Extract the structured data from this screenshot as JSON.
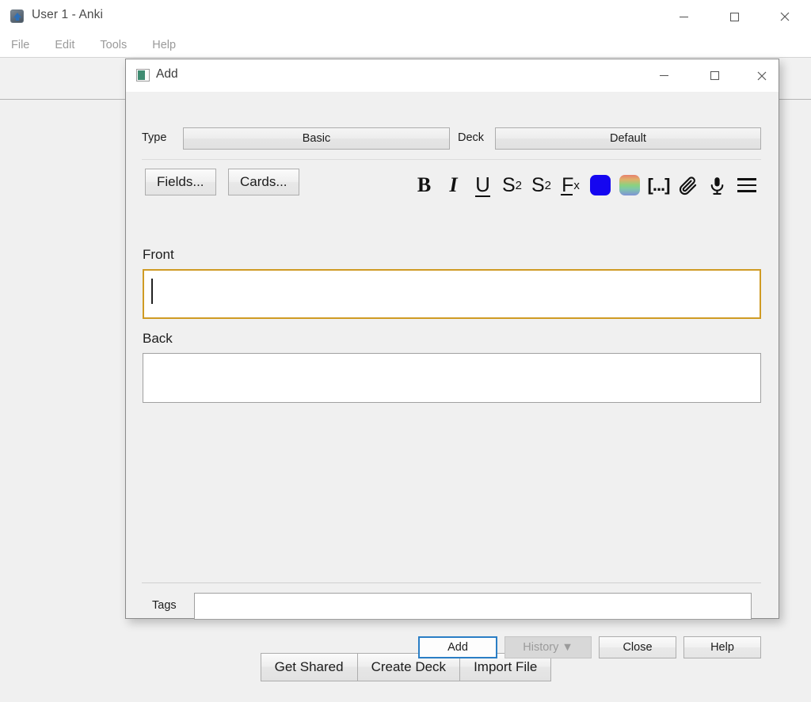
{
  "main_window": {
    "title": "User 1 - Anki",
    "app_icon": "anki-icon",
    "menu": [
      {
        "label": "File"
      },
      {
        "label": "Edit"
      },
      {
        "label": "Tools"
      },
      {
        "label": "Help"
      }
    ],
    "window_controls": {
      "minimize": "minimize-icon",
      "maximize": "maximize-icon",
      "close": "close-icon"
    },
    "bottom_buttons": [
      {
        "label": "Get Shared"
      },
      {
        "label": "Create Deck"
      },
      {
        "label": "Import File"
      }
    ]
  },
  "add_dialog": {
    "title": "Add",
    "icon": "note-icon",
    "window_controls": {
      "minimize": "minimize-icon",
      "maximize": "maximize-icon",
      "close": "close-icon"
    },
    "notetype": {
      "label": "Type",
      "value": "Basic"
    },
    "deck": {
      "label": "Deck",
      "value": "Default"
    },
    "editor_buttons": {
      "fields": "Fields...",
      "cards": "Cards..."
    },
    "format_tools": [
      {
        "name": "bold-icon",
        "glyph": "B"
      },
      {
        "name": "italic-icon",
        "glyph": "I"
      },
      {
        "name": "underline-icon",
        "glyph": "U"
      },
      {
        "name": "superscript-icon",
        "glyph": "S",
        "script": "2"
      },
      {
        "name": "subscript-icon",
        "glyph": "S",
        "script": "2"
      },
      {
        "name": "remove-formatting-icon",
        "glyph": "F",
        "script": "x"
      },
      {
        "name": "text-color-icon",
        "color": "#1506F0"
      },
      {
        "name": "color-picker-icon"
      },
      {
        "name": "cloze-deletion-icon",
        "glyph": "[...]"
      },
      {
        "name": "attach-media-icon"
      },
      {
        "name": "record-audio-icon"
      },
      {
        "name": "more-options-icon"
      }
    ],
    "fields": [
      {
        "label": "Front",
        "value": "",
        "focused": true
      },
      {
        "label": "Back",
        "value": "",
        "focused": false
      }
    ],
    "tags": {
      "label": "Tags",
      "value": "",
      "placeholder": ""
    },
    "action_buttons": [
      {
        "label": "Add",
        "state": "focused"
      },
      {
        "label": "History ▼",
        "state": "disabled"
      },
      {
        "label": "Close",
        "state": "normal"
      },
      {
        "label": "Help",
        "state": "normal"
      }
    ]
  },
  "colors": {
    "focus_field_border": "#CF9B24",
    "focus_button_border": "#2A7EC5",
    "window_bg": "#F0F0F0",
    "titlebar_bg": "#FFFFFF",
    "text_color_swatch": "#1506F0"
  }
}
